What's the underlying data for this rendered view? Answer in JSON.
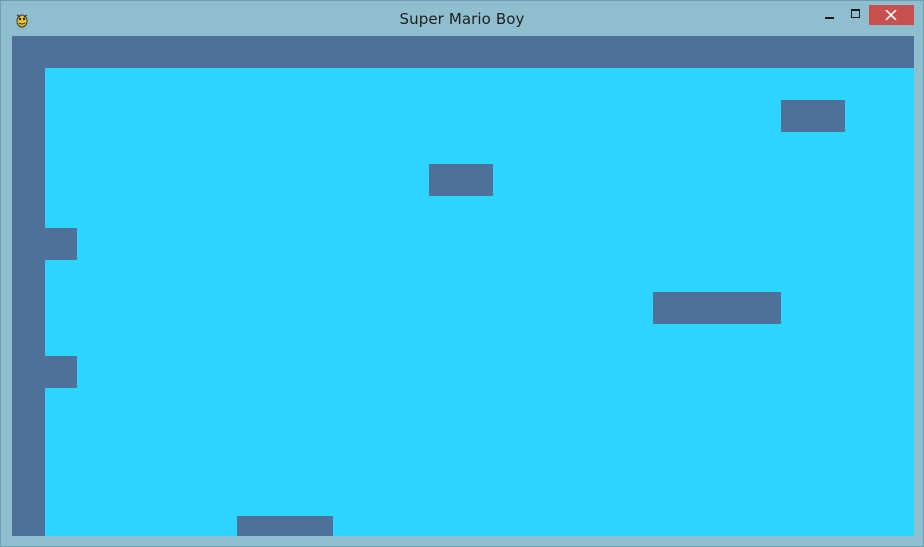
{
  "window": {
    "title": "Super Mario Boy",
    "app_icon": "pygame-snake-icon",
    "controls": {
      "minimize_icon": "minimize-icon",
      "maximize_icon": "maximize-icon",
      "close_icon": "close-icon"
    }
  },
  "colors": {
    "sky": "#2bd5ff",
    "wall": "#4e7099",
    "titlebar": "#8fbfce",
    "close_button": "#c7504f"
  }
}
